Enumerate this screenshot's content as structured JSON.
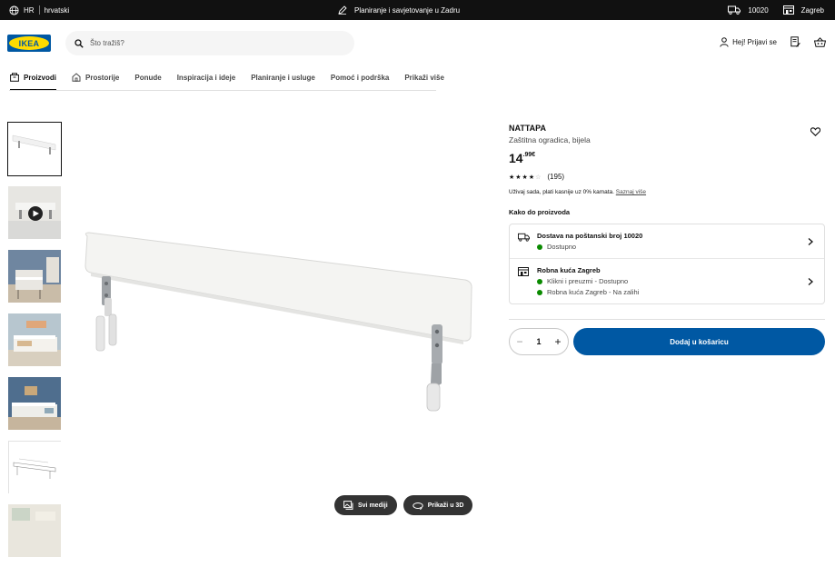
{
  "topbar": {
    "lang_code": "HR",
    "lang_name": "hrvatski",
    "center_text": "Planiranje i savjetovanje u Zadru",
    "postcode": "10020",
    "store": "Zagreb"
  },
  "header": {
    "logo_text": "IKEA",
    "search_placeholder": "Što tražiš?",
    "login_label": "Hej! Prijavi se"
  },
  "nav": {
    "items": [
      {
        "label": "Proizvodi"
      },
      {
        "label": "Prostorije"
      },
      {
        "label": "Ponude"
      },
      {
        "label": "Inspiracija i ideje"
      },
      {
        "label": "Planiranje i usluge"
      },
      {
        "label": "Pomoć i podrška"
      },
      {
        "label": "Prikaži više"
      }
    ]
  },
  "media": {
    "all_media": "Svi mediji",
    "view_3d": "Prikaži u 3D"
  },
  "product": {
    "name": "NATTAPA",
    "description": "Zaštitna ogradica, bijela",
    "price_whole": "14",
    "price_decimal": ".99€",
    "reviews_count": "(195)",
    "rating": 4.5,
    "credit_text": "Uživaj sada, plati kasnije uz 0% kamata.",
    "credit_link": "Saznaj više",
    "how_to_get": "Kako do proizvoda",
    "delivery_title": "Dostava na poštanski broj 10020",
    "delivery_status": "Dostupno",
    "store_title": "Robna kuća Zagreb",
    "store_line1": "Klikni i preuzmi - Dostupno",
    "store_line2": "Robna kuća Zagreb - Na zalihi",
    "quantity": "1",
    "add_to_cart": "Dodaj u košaricu"
  },
  "colors": {
    "brand_blue": "#0058a3",
    "brand_yellow": "#ffdb00",
    "available_green": "#0a8a00"
  }
}
